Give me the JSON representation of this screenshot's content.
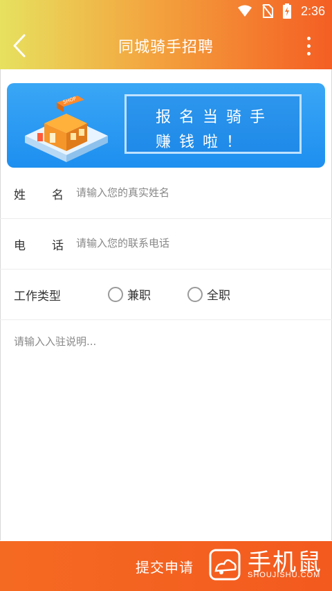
{
  "status_bar": {
    "time": "2:36",
    "icons": [
      "wifi-icon",
      "no-sim-icon",
      "battery-charging-icon"
    ]
  },
  "header": {
    "title": "同城骑手招聘",
    "back_icon": "chevron-left-icon",
    "more_icon": "more-vertical-icon"
  },
  "banner": {
    "line1": "报名当骑手",
    "line2": "赚钱啦！",
    "illustration": "shop-building-illustration"
  },
  "form": {
    "name_label": "姓  名",
    "name_placeholder": "请输入您的真实姓名",
    "phone_label": "电  话",
    "phone_placeholder": "请输入您的联系电话",
    "job_type_label": "工作类型",
    "job_type_options": [
      "兼职",
      "全职"
    ],
    "description_placeholder": "请输入入驻说明..."
  },
  "submit": {
    "label": "提交申请"
  },
  "watermark": {
    "text": "手机鼠",
    "sub": "SHOUJISHU.COM"
  },
  "colors": {
    "header_start": "#e7e15f",
    "header_end": "#f45e23",
    "banner_blue": "#2a9af2",
    "submit_orange": "#f5641f"
  }
}
